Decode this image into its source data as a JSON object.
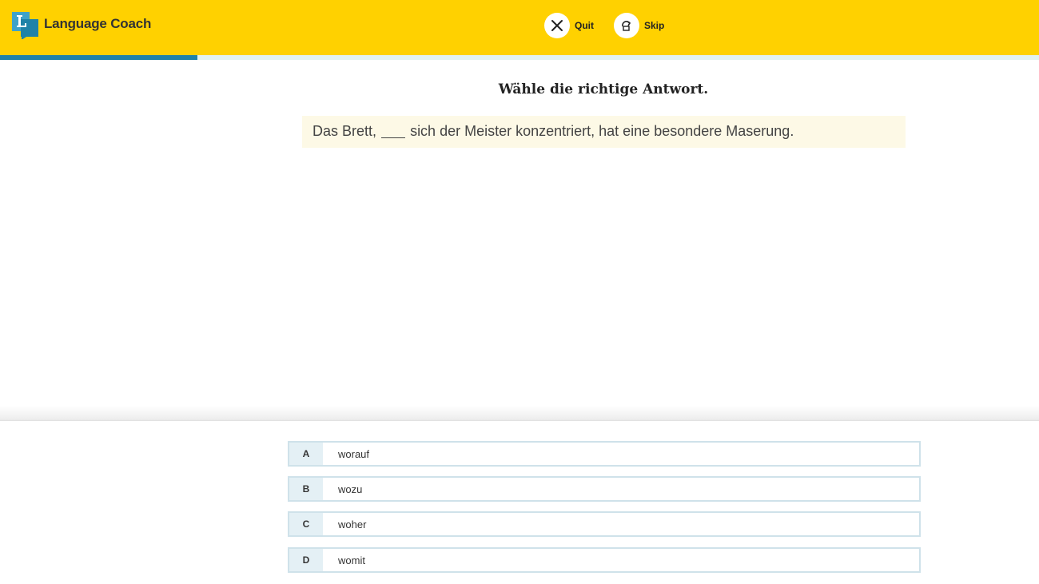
{
  "app": {
    "title": "Language Coach",
    "accent_color": "#ffd100",
    "progress_color": "#1f82a8",
    "progress_fraction": 0.19
  },
  "header": {
    "quit_label": "Quit",
    "skip_label": "Skip",
    "quit_icon": "close-icon",
    "skip_icon": "skip-icon"
  },
  "exercise": {
    "instruction": "Wähle die richtige Antwort.",
    "sentence_before": "Das Brett,",
    "sentence_after": "sich der Meister konzentriert, hat eine besondere Maserung."
  },
  "answers": [
    {
      "letter": "A",
      "text": "worauf"
    },
    {
      "letter": "B",
      "text": "wozu"
    },
    {
      "letter": "C",
      "text": "woher"
    },
    {
      "letter": "D",
      "text": "womit"
    }
  ]
}
